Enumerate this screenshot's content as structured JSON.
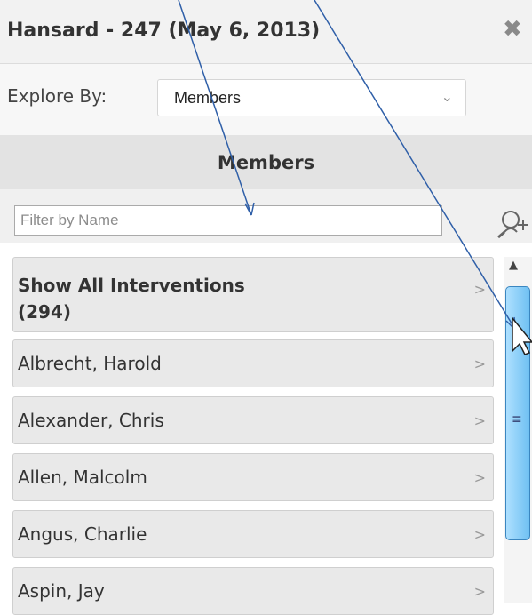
{
  "panel": {
    "title": "Hansard - 247 (May 6, 2013)",
    "close_icon": "close-icon",
    "explore_label": "Explore By:",
    "explore_value": "Members",
    "section_title": "Members",
    "filter_placeholder": "Filter by Name",
    "search_icon": "person-search-icon"
  },
  "list": {
    "items": [
      {
        "label": "Show All Interventions\n(294)",
        "arrow": ">"
      },
      {
        "label": "Albrecht, Harold",
        "arrow": ">"
      },
      {
        "label": "Alexander, Chris",
        "arrow": ">"
      },
      {
        "label": "Allen, Malcolm",
        "arrow": ">"
      },
      {
        "label": "Angus, Charlie",
        "arrow": ">"
      },
      {
        "label": "Aspin, Jay",
        "arrow": ">"
      }
    ]
  },
  "scrollbar": {
    "up_icon": "scroll-up-arrow-icon",
    "grip_icon": "scroll-grip-icon",
    "grip": "≡",
    "up": "▲"
  },
  "colors": {
    "annotation_arrows": "#2f5fa8",
    "scroll_thumb": "#6fc0f2"
  }
}
